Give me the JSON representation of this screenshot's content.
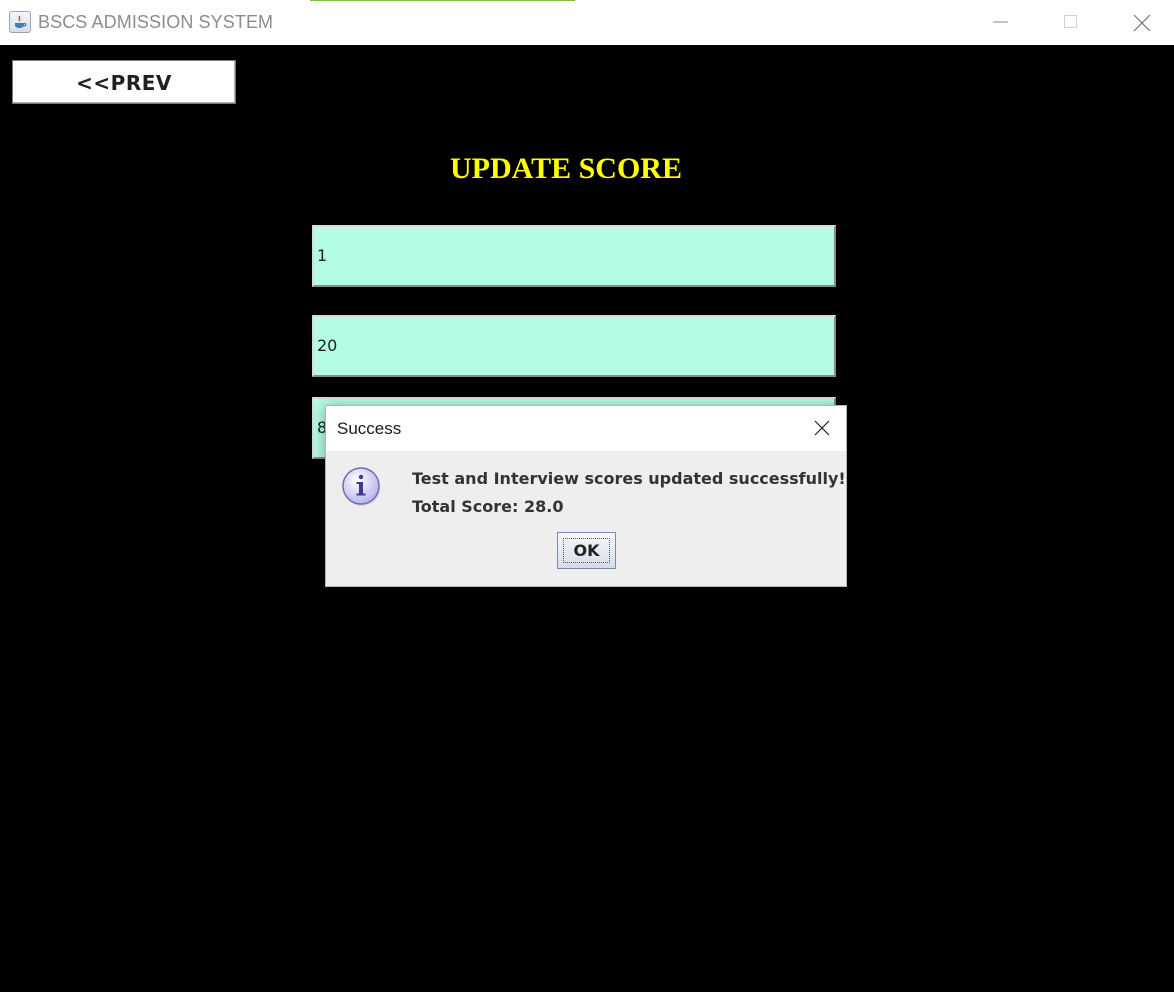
{
  "window": {
    "title": "BSCS ADMISSION SYSTEM",
    "icons": {
      "app": "java-icon",
      "minimize": "minimize-icon",
      "maximize": "maximize-icon",
      "close": "close-icon"
    }
  },
  "main": {
    "prev_label": "<<PREV",
    "heading": "UPDATE SCORE",
    "fields": [
      "1",
      "20",
      "8"
    ],
    "colors": {
      "background": "#000000",
      "heading": "#ffff00",
      "field": "#b3fde5"
    }
  },
  "dialog": {
    "title": "Success",
    "message_line1": "Test and Interview scores updated successfully!",
    "message_line2": "Total Score: 28.0",
    "ok_label": "OK",
    "icon": "info-icon"
  }
}
